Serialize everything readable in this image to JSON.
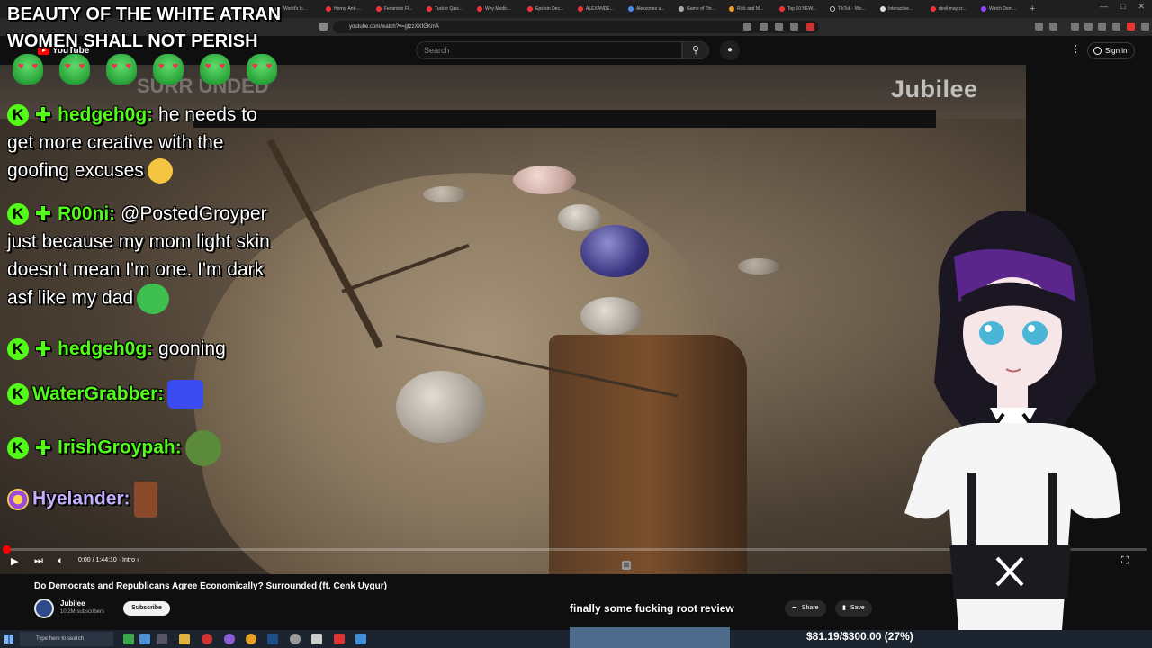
{
  "browser": {
    "tabs": [
      "World's Ic...",
      "Horny, Anti-...",
      "Feminists Fl...",
      "Tucker Qais...",
      "Why Medic...",
      "Epstein Dec...",
      "ALEXANDE...",
      "Alexzones u...",
      "Game of Thr...",
      "Rick and M...",
      "Top 10 NEW...",
      "TikTok - Mix...",
      "Interactive...",
      "devil may cr...",
      "Watch Dem..."
    ],
    "url": "youtube.com/watch?v=gfzzXXfGKmA"
  },
  "youtube": {
    "logo": "YouTube",
    "search_placeholder": "Search",
    "signin": "Sign in"
  },
  "player": {
    "brand_watermark": "Jubilee",
    "series_watermark": "SURR UNDED",
    "time": "0:00 / 1:44:10 · Intro ›",
    "progress_fraction": 0.0
  },
  "video": {
    "title": "Do Democrats and Republicans Agree Economically? Surrounded (ft. Cenk Uygur)",
    "channel": "Jubilee",
    "subscribers": "10.2M subscribers",
    "subscribe": "Subscribe",
    "share": "Share",
    "save": "Save"
  },
  "overlay": {
    "title_line1": "BEAUTY OF THE WHITE ATRAN",
    "title_line2": "WOMEN SHALL NOT PERISH",
    "emote_count": 6,
    "popup": "finally some fucking root review",
    "donation": "$81.19/$300.00 (27%)"
  },
  "chat": [
    {
      "user": "hedgeh0g:",
      "line1": "he needs to",
      "line2": "get more creative with the",
      "line3": "goofing excuses"
    },
    {
      "user": "R00ni:",
      "line1": "@PostedGroyper",
      "line2": "just because my mom light skin",
      "line3": "doesn't mean I'm one. I'm dark",
      "line4": "asf like my dad"
    },
    {
      "user": "hedgeh0g:",
      "line1": "gooning"
    },
    {
      "user": "WaterGrabber:"
    },
    {
      "user": "IrishGroypah:"
    },
    {
      "user": "Hyelander:"
    }
  ],
  "taskbar": {
    "search": "Type here to search"
  },
  "colors": {
    "kick_green": "#53fc18",
    "youtube_red": "#ff0000"
  }
}
